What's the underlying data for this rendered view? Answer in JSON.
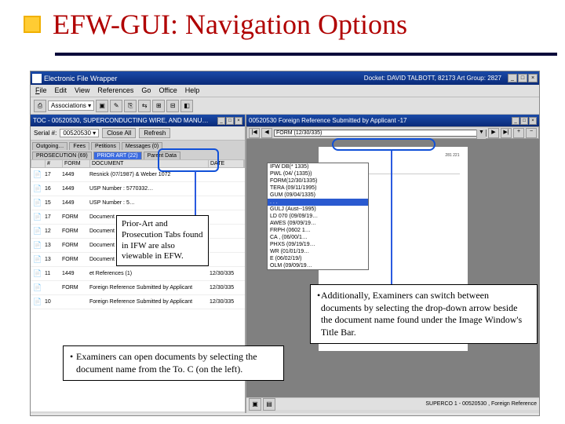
{
  "slide": {
    "title": "EFW-GUI: Navigation Options"
  },
  "window": {
    "app_title": "Electronic File Wrapper",
    "docket_label": "Docket: DAVID TALBOTT, 82173   Art Group: 2827"
  },
  "menu": {
    "file": "File",
    "edit": "Edit",
    "view": "View",
    "references": "References",
    "go": "Go",
    "office": "Office",
    "help": "Help"
  },
  "toolbar": {
    "assoc_label": "Associations",
    "arrow": "▾"
  },
  "left": {
    "pane_title": "TOC - 00520530, SUPERCONDUCTING WIRE, AND MANU…",
    "serial_label": "Serial #:",
    "serial_value": "00520530",
    "close_btn": "Close All",
    "refresh_btn": "Refresh",
    "tabs": {
      "outgoing": "Outgoing…",
      "fees": "Fees",
      "petitions": "Petitions",
      "messages": "Messages (0)",
      "prosecution": "PROSECUTION (69)",
      "prior_art": "PRIOR ART (22)",
      "parent": "Parent Data"
    },
    "headers": {
      "a": "",
      "b": "#",
      "c": "FORM",
      "d": "DOCUMENT",
      "e": "DATE"
    },
    "rows": [
      {
        "i": "📄",
        "n": "17",
        "f": "1449",
        "d": "Resnick (07/1987) & Weber 1072",
        "e": ""
      },
      {
        "i": "📄",
        "n": "16",
        "f": "1449",
        "d": "USP Number : 5770332…",
        "e": ""
      },
      {
        "i": "📄",
        "n": "15",
        "f": "1449",
        "d": "USP Number : 5…",
        "e": ""
      },
      {
        "i": "📄",
        "n": "17",
        "f": "FORM",
        "d": "Document",
        "e": ""
      },
      {
        "i": "📄",
        "n": "12",
        "f": "FORM",
        "d": "Document",
        "e": ""
      },
      {
        "i": "📄",
        "n": "13",
        "f": "FORM",
        "d": "Document",
        "e": ""
      },
      {
        "i": "📄",
        "n": "13",
        "f": "FORM",
        "d": "Document",
        "e": ""
      },
      {
        "i": "📄",
        "n": "11",
        "f": "1449",
        "d": "et References (1)",
        "e": "12/30/335"
      },
      {
        "i": "📄",
        "n": "",
        "f": "FORM",
        "d": "Foreign Reference Submitted by Applicant",
        "e": "12/30/335"
      },
      {
        "i": "📄",
        "n": "10",
        "f": "",
        "d": "Foreign Reference Submitted by Applicant",
        "e": "12/30/335"
      }
    ]
  },
  "right": {
    "pane_title": "00520530 Foreign Reference Submitted by Applicant -17",
    "dropdown_value": "FORM (12/30/335)",
    "dropdown_items": [
      "IFW DB(* 1335)",
      "PWL (04/ (1335))",
      "FORM(12/30/1335)",
      "TERA (09/11/1995)",
      "GUM (09/04/1335)",
      ". . .",
      "GULJ (Aust--1995)",
      "LD 070 (09/09/19…",
      "AWES (09/09/19…",
      "FRPH (0602 1…",
      "CA , (06/00/1…",
      "PHXS (09/19/19…",
      "WR (01/01/19…",
      "E (06/02/19/)",
      "OLM (09/09/19…"
    ],
    "btm_left": "SUPERCO 1 - 00520530 , Foreign Reference"
  },
  "callouts": {
    "c1": "Prior-Art and Prosecution Tabs found in IFW are also viewable in EFW.",
    "c2": "Examiners can open documents by selecting the document name from the To. C (on the left).",
    "c3": "Additionally, Examiners can switch between documents by selecting the drop-down arrow beside the document name found under the Image Window's Title Bar."
  },
  "icons": {
    "min": "_",
    "max": "□",
    "close": "×",
    "left": "◀",
    "right": "▶",
    "first": "|◀",
    "last": "▶|"
  }
}
